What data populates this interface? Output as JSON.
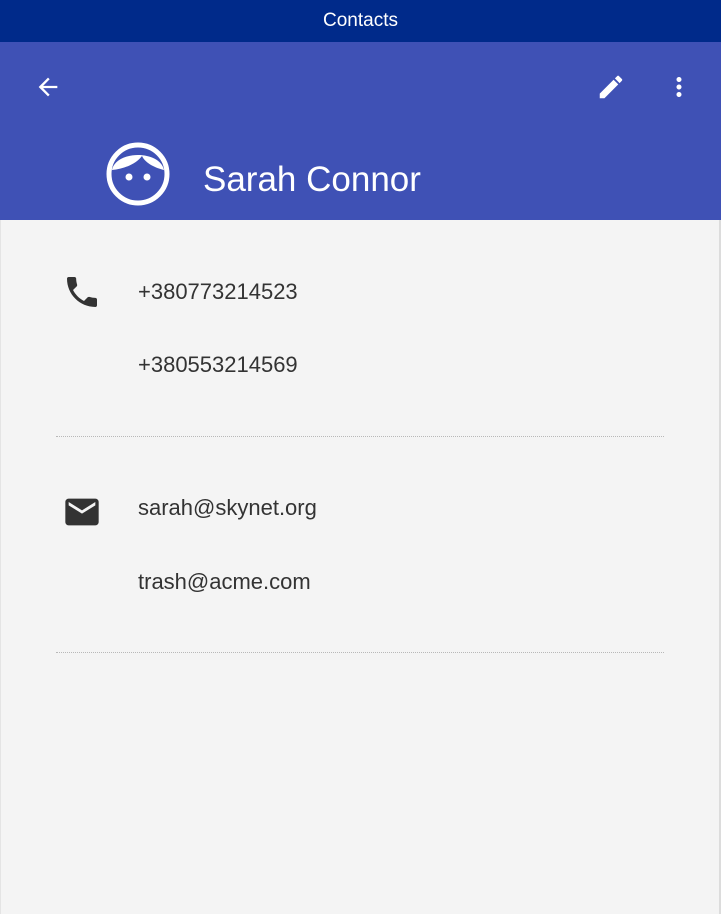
{
  "window": {
    "title": "Contacts"
  },
  "toolbar": {
    "back_icon": "arrow-back-icon",
    "edit_icon": "pencil-icon",
    "more_icon": "more-vert-icon",
    "color": "#3f51b5"
  },
  "contact": {
    "avatar_icon": "face-icon",
    "name": "Sarah Connor",
    "phones": [
      "+380773214523",
      "+380553214569"
    ],
    "emails": [
      "sarah@skynet.org",
      "trash@acme.com"
    ]
  },
  "colors": {
    "titlebar": "#002a8a",
    "appbar": "#3f51b5",
    "background": "#f4f4f4",
    "text": "#333333"
  }
}
